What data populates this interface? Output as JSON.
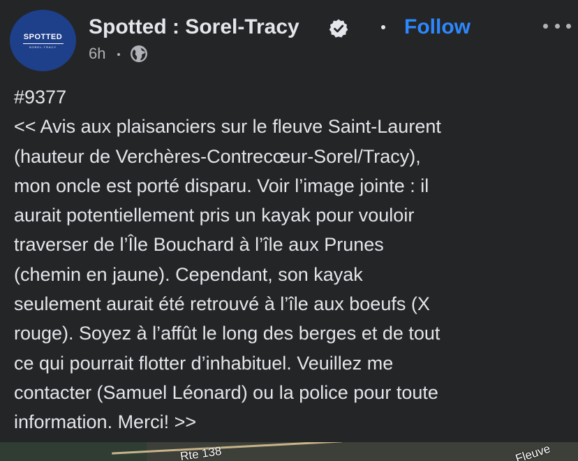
{
  "post": {
    "page_name": "Spotted : Sorel-Tracy",
    "follow_label": "Follow",
    "timestamp": "6h",
    "audience_icon": "globe-icon",
    "verified_icon": "verified-badge-icon",
    "more_icon": "more-options-icon",
    "avatar": {
      "logo_text": "SPOTTED",
      "sub_text": "SOREL-TRACY"
    },
    "body": "#9377\n<< Avis aux plaisanciers sur le fleuve Saint-Laurent\n(hauteur de Verchères-Contrecœur-Sorel/Tracy),\nmon oncle est porté disparu. Voir l’image jointe : il\naurait potentiellement pris un kayak pour vouloir\ntraverser de l’Île Bouchard à l’île aux Prunes\n(chemin en jaune). Cependant, son kayak\nseulement aurait été retrouvé à l’île aux boeufs (X\nrouge). Soyez à l’affût le long des berges et de tout\nce qui pourrait flotter d’inhabituel. Veuillez me\ncontacter (Samuel Léonard) ou la police pour toute\ninformation. Merci! >>"
  },
  "map": {
    "route_label": "Rte 138",
    "river_label": "Fleuve"
  },
  "colors": {
    "background": "#242526",
    "text_primary": "#e4e6eb",
    "text_secondary": "#b0b3b8",
    "follow_blue": "#2d88ff",
    "avatar_blue": "#1e3f8a"
  }
}
